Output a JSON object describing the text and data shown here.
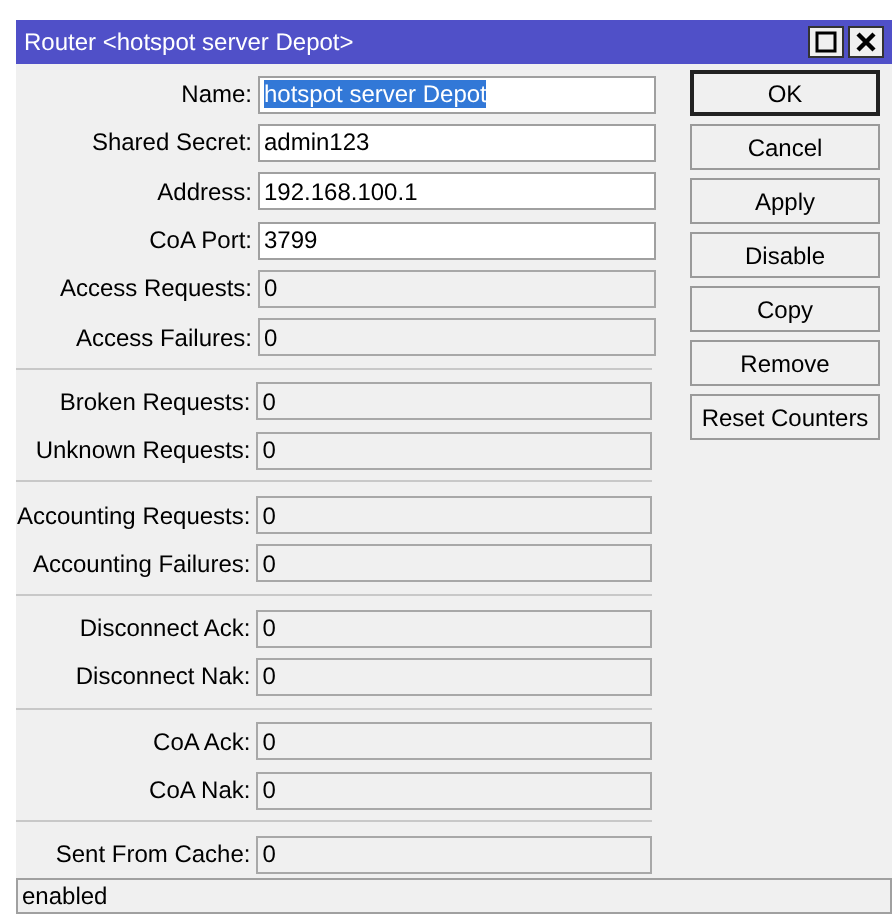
{
  "window": {
    "title": "Router <hotspot server Depot>"
  },
  "field_groups": [
    {
      "fields": [
        {
          "label": "Name:",
          "value": "hotspot server Depot",
          "kind": "editable",
          "highlighted": true
        },
        {
          "label": "Shared Secret:",
          "value": "admin123",
          "kind": "editable",
          "highlighted": false
        },
        {
          "label": "Address:",
          "value": "192.168.100.1",
          "kind": "editable",
          "highlighted": false
        },
        {
          "label": "CoA Port:",
          "value": "3799",
          "kind": "editable",
          "highlighted": false
        },
        {
          "label": "Access Requests:",
          "value": "0",
          "kind": "readonly",
          "highlighted": false
        },
        {
          "label": "Access Failures:",
          "value": "0",
          "kind": "readonly",
          "highlighted": false
        }
      ]
    },
    {
      "fields": [
        {
          "label": "Broken Requests:",
          "value": "0",
          "kind": "readonly",
          "highlighted": false
        },
        {
          "label": "Unknown Requests:",
          "value": "0",
          "kind": "readonly",
          "highlighted": false
        }
      ]
    },
    {
      "fields": [
        {
          "label": "Accounting Requests:",
          "value": "0",
          "kind": "readonly",
          "highlighted": false
        },
        {
          "label": "Accounting Failures:",
          "value": "0",
          "kind": "readonly",
          "highlighted": false
        }
      ]
    },
    {
      "fields": [
        {
          "label": "Disconnect Ack:",
          "value": "0",
          "kind": "readonly",
          "highlighted": false
        },
        {
          "label": "Disconnect Nak:",
          "value": "0",
          "kind": "readonly",
          "highlighted": false
        }
      ]
    },
    {
      "fields": [
        {
          "label": "CoA Ack:",
          "value": "0",
          "kind": "readonly",
          "highlighted": false
        },
        {
          "label": "CoA Nak:",
          "value": "0",
          "kind": "readonly",
          "highlighted": false
        }
      ]
    },
    {
      "fields": [
        {
          "label": "Sent From Cache:",
          "value": "0",
          "kind": "readonly",
          "highlighted": false
        }
      ]
    }
  ],
  "buttons": [
    {
      "label": "OK",
      "default": true
    },
    {
      "label": "Cancel",
      "default": false
    },
    {
      "label": "Apply",
      "default": false
    },
    {
      "label": "Disable",
      "default": false
    },
    {
      "label": "Copy",
      "default": false
    },
    {
      "label": "Remove",
      "default": false
    },
    {
      "label": "Reset Counters",
      "default": false
    }
  ],
  "status_bar": {
    "text": "enabled"
  }
}
